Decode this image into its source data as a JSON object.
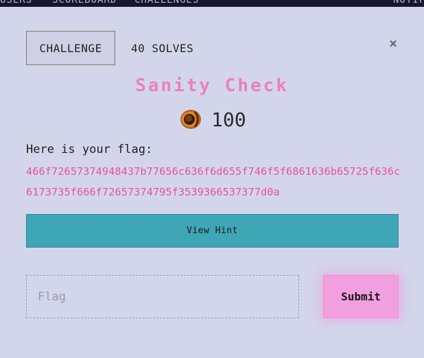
{
  "topnav": {
    "items": [
      "USERS",
      "SCOREBOARD",
      "CHALLENGES",
      "NOTIFICATIONS"
    ]
  },
  "modal": {
    "tabs": {
      "challenge_label": "CHALLENGE",
      "solves_label": "40 SOLVES"
    },
    "close_symbol": "×",
    "title": "Sanity Check",
    "points": "100",
    "coin_icon": "coin-icon",
    "flag_label": "Here is your flag:",
    "flag_value": "466f72657374948437b77656c636f6d655f746f5f6861636b65725f636c6173735f666f72657374795f3539366537377d0a",
    "hint_button": "View Hint",
    "flag_input": {
      "placeholder": "Flag",
      "value": ""
    },
    "submit_button": "Submit"
  },
  "colors": {
    "background": "#d3d6ea",
    "title": "#ea7fc2",
    "flag_text": "#ea4fa0",
    "hint_button": "#3fa6b6",
    "submit_button": "#f29fe0"
  }
}
